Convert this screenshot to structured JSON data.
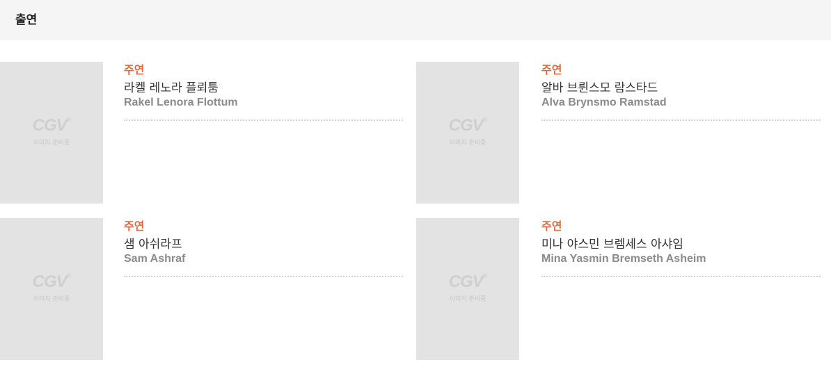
{
  "section": {
    "title": "출연"
  },
  "placeholder": {
    "logo": "CGV",
    "logo_mark": "®",
    "caption": "이미지 준비중"
  },
  "cast": [
    {
      "role": "주연",
      "name_ko": "라켈 레노라 플뢰툼",
      "name_en": "Rakel Lenora Flottum"
    },
    {
      "role": "주연",
      "name_ko": "알바 브륀스모 람스타드",
      "name_en": "Alva Brynsmo Ramstad"
    },
    {
      "role": "주연",
      "name_ko": "샘 아쉬라프",
      "name_en": "Sam Ashraf"
    },
    {
      "role": "주연",
      "name_ko": "미나 야스민 브렘세스 아샤임",
      "name_en": "Mina Yasmin Bremseth Asheim"
    }
  ],
  "colors": {
    "role": "#e0693e",
    "header_bg": "#f5f5f5",
    "photo_bg": "#e3e3e3"
  }
}
